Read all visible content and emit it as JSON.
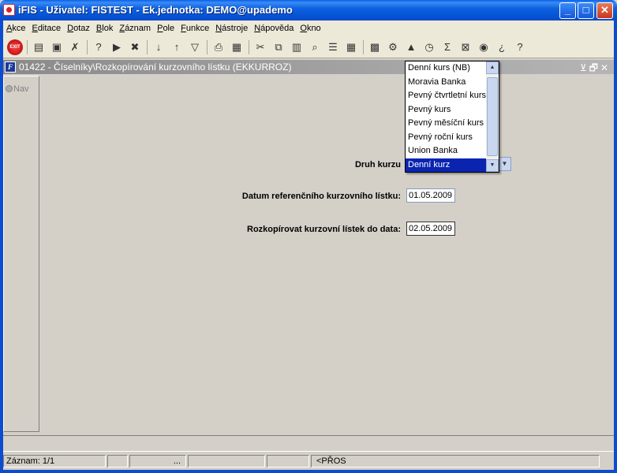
{
  "window": {
    "title": "iFIS - Uživatel: FISTEST - Ek.jednotka: DEMO@upademo",
    "minimize": "_",
    "maximize": "□",
    "close": "✕"
  },
  "menu": [
    {
      "hot": "A",
      "rest": "kce"
    },
    {
      "hot": "E",
      "rest": "ditace"
    },
    {
      "hot": "D",
      "rest": "otaz"
    },
    {
      "hot": "B",
      "rest": "lok"
    },
    {
      "hot": "Z",
      "rest": "áznam"
    },
    {
      "hot": "P",
      "rest": "ole"
    },
    {
      "hot": "F",
      "rest": "unkce"
    },
    {
      "hot": "N",
      "rest": "ástroje"
    },
    {
      "hot": "N",
      "rest": "ápověda"
    },
    {
      "hot": "O",
      "rest": "kno"
    }
  ],
  "toolbar": {
    "exit_label": "EXIT",
    "icons": [
      "insert-record-icon",
      "save-icon",
      "delete-record-icon",
      "query-enter-icon",
      "query-execute-icon",
      "query-cancel-icon",
      "sort-asc-icon",
      "sort-desc-icon",
      "filter-icon",
      "print-icon",
      "preview-icon",
      "cut-icon",
      "copy-icon",
      "paste-icon",
      "find-icon",
      "list-icon",
      "table-icon",
      "calculator-icon",
      "settings-icon",
      "chart-icon",
      "clock-icon",
      "sum-icon",
      "excel-icon",
      "browser-icon",
      "help-search-icon",
      "help-icon"
    ]
  },
  "child": {
    "title": "01422 - Číselníky\\Rozkopírování kurzovního lístku (EKKURROZ)",
    "icon_letter": "F",
    "controls": "⊻🗗✕"
  },
  "nav": {
    "label": "Nav"
  },
  "form": {
    "druh_kurzu_label": "Druh kurzu",
    "datum_label": "Datum referenčního kurzovního lístku:",
    "datum_value": "01.05.2009",
    "rozkop_label": "Rozkopírovat kurzovní lístek do data:",
    "rozkop_value": "02.05.2009"
  },
  "dropdown": {
    "items": [
      "Denní kurs (NB)",
      "Moravia Banka",
      "Pevný čtvrtletní kurs",
      "Pevný kurs",
      "Pevný měsíční kurs",
      "Pevný roční kurs",
      "Union Banka",
      "Denní kurz"
    ],
    "selected_index": 7
  },
  "status": {
    "record": "Záznam: 1/1",
    "c2": "",
    "c3": "...",
    "c4": "",
    "c5": "",
    "mode": "<PŘOS"
  }
}
